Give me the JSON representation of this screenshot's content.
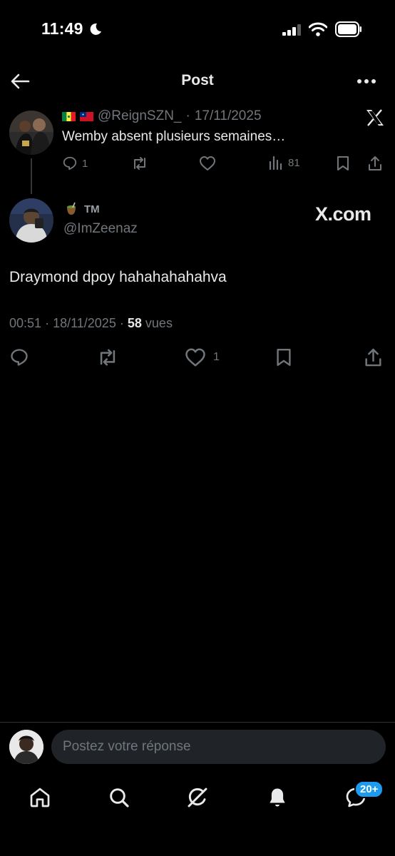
{
  "status_bar": {
    "time": "11:49"
  },
  "header": {
    "title": "Post"
  },
  "parent_post": {
    "handle": "@ReignSZN_",
    "separator": "·",
    "date": "17/11/2025",
    "text": "Wemby absent plusieurs semaines…",
    "replies": "1",
    "views": "81"
  },
  "main_post": {
    "display_name": "TM",
    "handle": "@ImZeenaz",
    "watermark": "X.com",
    "text": "Draymond dpoy hahahahahahva",
    "time": "00:51",
    "sep1": "·",
    "date": "18/11/2025",
    "sep2": "·",
    "views_count": "58",
    "views_label": "vues",
    "likes": "1"
  },
  "reply": {
    "placeholder": "Postez votre réponse"
  },
  "nav": {
    "messages_badge": "20+"
  },
  "colors": {
    "background": "#000000",
    "text": "#e7e9ea",
    "muted": "#71767b",
    "accent": "#1d9bf0"
  },
  "icons": [
    "moon-icon",
    "signal-icon",
    "wifi-icon",
    "battery-icon",
    "back-arrow-icon",
    "more-icon",
    "x-logo-icon",
    "reply-icon",
    "repost-icon",
    "like-icon",
    "views-icon",
    "bookmark-icon",
    "share-icon",
    "home-icon",
    "search-icon",
    "grok-icon",
    "notifications-icon",
    "messages-icon"
  ]
}
